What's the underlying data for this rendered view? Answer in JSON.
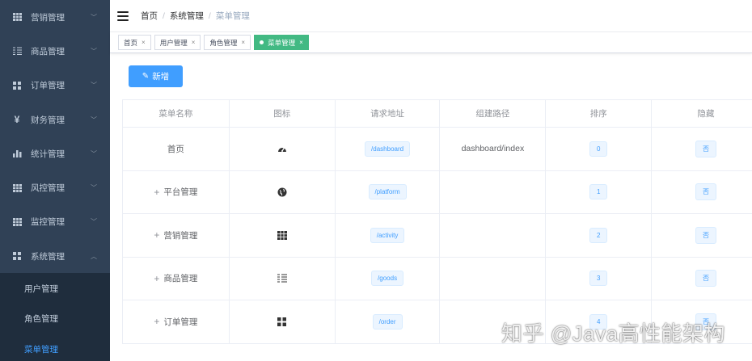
{
  "sidebar": {
    "items": [
      {
        "label": "营销管理",
        "icon": "grid-icon"
      },
      {
        "label": "商品管理",
        "icon": "list-icon"
      },
      {
        "label": "订单管理",
        "icon": "apps-icon"
      },
      {
        "label": "财务管理",
        "icon": "yen-icon"
      },
      {
        "label": "统计管理",
        "icon": "bar-chart-icon"
      },
      {
        "label": "风控管理",
        "icon": "grid-icon"
      },
      {
        "label": "监控管理",
        "icon": "grid-icon"
      },
      {
        "label": "系统管理",
        "icon": "apps-icon",
        "expanded": true
      }
    ],
    "sub_items": [
      {
        "label": "用户管理"
      },
      {
        "label": "角色管理"
      },
      {
        "label": "菜单管理",
        "active": true
      }
    ]
  },
  "breadcrumb": {
    "items": [
      "首页",
      "系统管理",
      "菜单管理"
    ],
    "separator": "/"
  },
  "tags": [
    {
      "label": "首页"
    },
    {
      "label": "用户管理"
    },
    {
      "label": "角色管理"
    },
    {
      "label": "菜单管理",
      "active": true
    }
  ],
  "toolbar": {
    "add_label": "新增"
  },
  "table": {
    "headers": [
      "菜单名称",
      "图标",
      "请求地址",
      "组建路径",
      "排序",
      "隐藏"
    ],
    "rows": [
      {
        "name": "首页",
        "expand": "",
        "icon": "dashboard-icon",
        "path": "/dashboard",
        "component": "dashboard/index",
        "sort": "0",
        "hidden": "否"
      },
      {
        "name": "平台管理",
        "expand": "+",
        "icon": "globe-icon",
        "path": "/platform",
        "component": "",
        "sort": "1",
        "hidden": "否"
      },
      {
        "name": "营销管理",
        "expand": "+",
        "icon": "grid-icon",
        "path": "/activity",
        "component": "",
        "sort": "2",
        "hidden": "否"
      },
      {
        "name": "商品管理",
        "expand": "+",
        "icon": "list-icon",
        "path": "/goods",
        "component": "",
        "sort": "3",
        "hidden": "否"
      },
      {
        "name": "订单管理",
        "expand": "+",
        "icon": "apps-icon",
        "path": "/order",
        "component": "",
        "sort": "4",
        "hidden": "否"
      }
    ]
  },
  "watermark": "知乎 @Java高性能架构",
  "colors": {
    "sidebar_bg": "#304156",
    "submenu_bg": "#1f2d3d",
    "primary": "#409eff",
    "tag_active": "#42b983"
  }
}
